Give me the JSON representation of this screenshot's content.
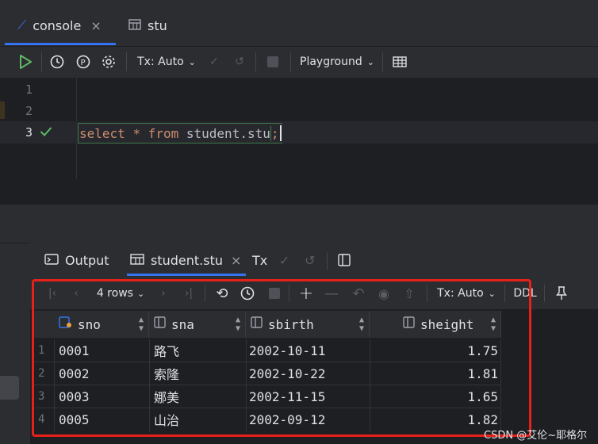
{
  "tabs": [
    {
      "label": "console",
      "close": "×",
      "active": true
    },
    {
      "label": "stu",
      "active": false
    }
  ],
  "toolbar": {
    "tx_label": "Tx: Auto",
    "playground_label": "Playground"
  },
  "editor": {
    "line_numbers": [
      "1",
      "2",
      "3"
    ],
    "code": {
      "kw_select": "select",
      "star": "*",
      "kw_from": "from",
      "table": "student.stu",
      "semicolon": ";"
    }
  },
  "services": {
    "output_label": "Output",
    "result_tab_label": "student.stu",
    "close": "×",
    "tx_label": "Tx"
  },
  "grid_toolbar": {
    "rows_label": "4 rows",
    "tx_label": "Tx: Auto",
    "ddl_label": "DDL"
  },
  "table": {
    "columns": [
      {
        "name": "sno"
      },
      {
        "name": "sna"
      },
      {
        "name": "sbirth"
      },
      {
        "name": "sheight"
      }
    ],
    "rows": [
      {
        "num": "1",
        "sno": "0001",
        "sna": "路飞",
        "sbirth": "2002-10-11",
        "sheight": "1.75"
      },
      {
        "num": "2",
        "sno": "0002",
        "sna": "索隆",
        "sbirth": "2002-10-22",
        "sheight": "1.81"
      },
      {
        "num": "3",
        "sno": "0003",
        "sna": "娜美",
        "sbirth": "2002-11-15",
        "sheight": "1.65"
      },
      {
        "num": "4",
        "sno": "0005",
        "sna": "山治",
        "sbirth": "2002-09-12",
        "sheight": "1.82"
      }
    ]
  },
  "watermark": "CSDN @艾伦~耶格尔",
  "colors": {
    "accent": "#3574f0",
    "run_green": "#5fb865",
    "keyword": "#cf8e6d",
    "highlight_box": "#e5211a"
  }
}
